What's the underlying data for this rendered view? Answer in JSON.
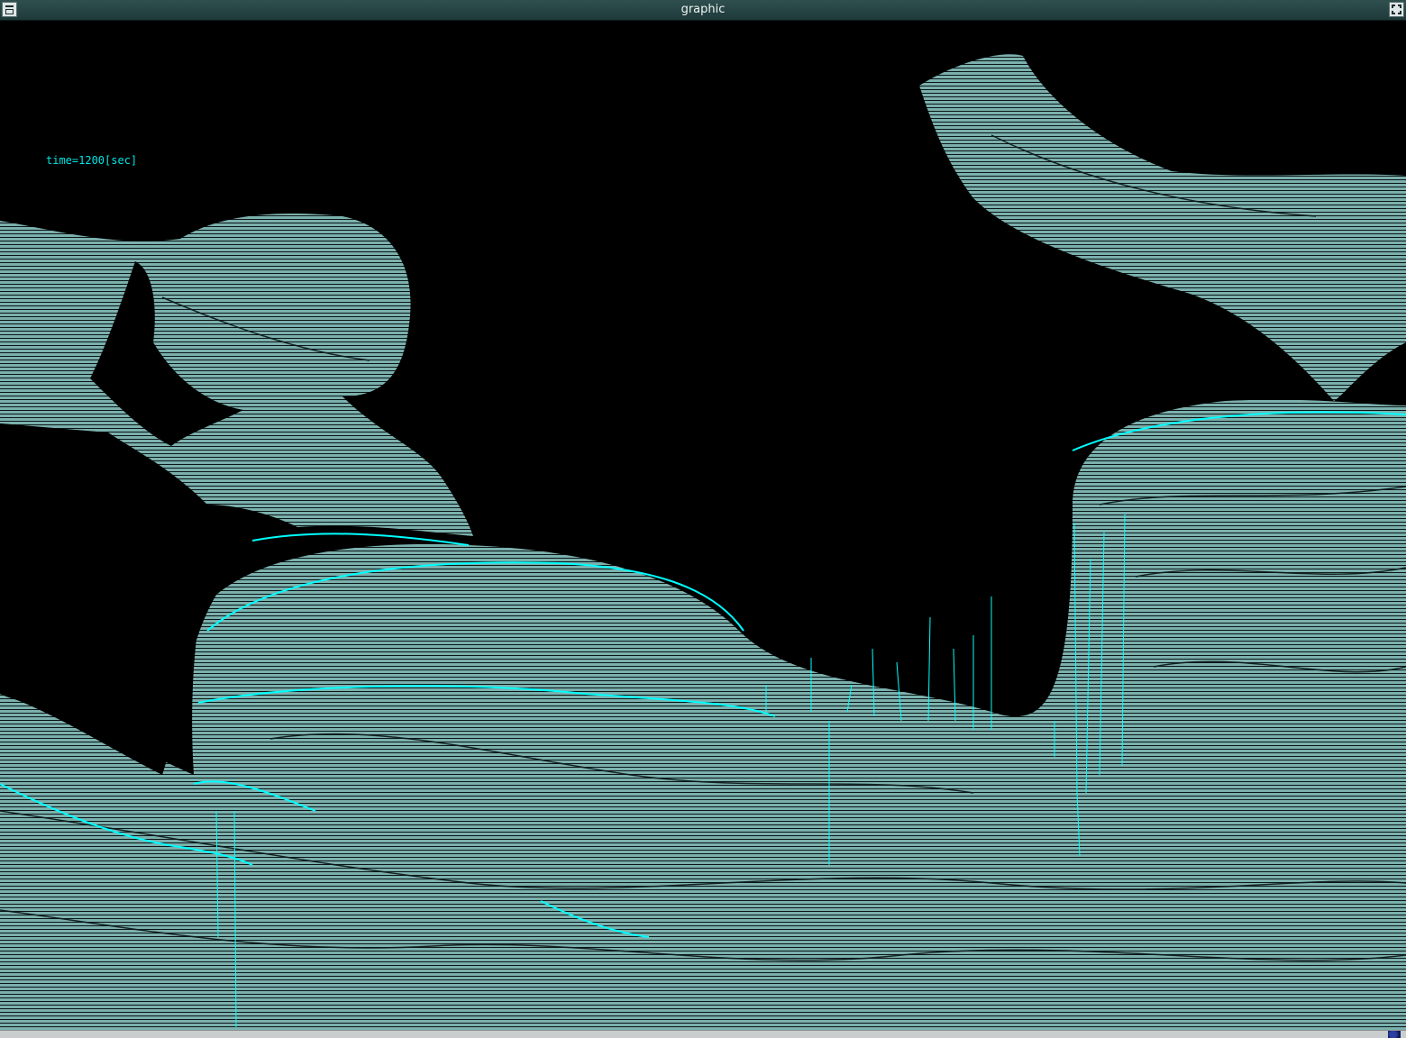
{
  "window": {
    "title": "graphic",
    "menu_icon": "window-menu-icon",
    "maximize_icon": "maximize-icon"
  },
  "plot": {
    "time_label": "time=1200[sec]",
    "colors": {
      "background": "#000000",
      "surface": "#00ffff",
      "fill": "#6aa3a0"
    }
  },
  "statusbar": {
    "tray_icon": "system-tray-icon"
  }
}
